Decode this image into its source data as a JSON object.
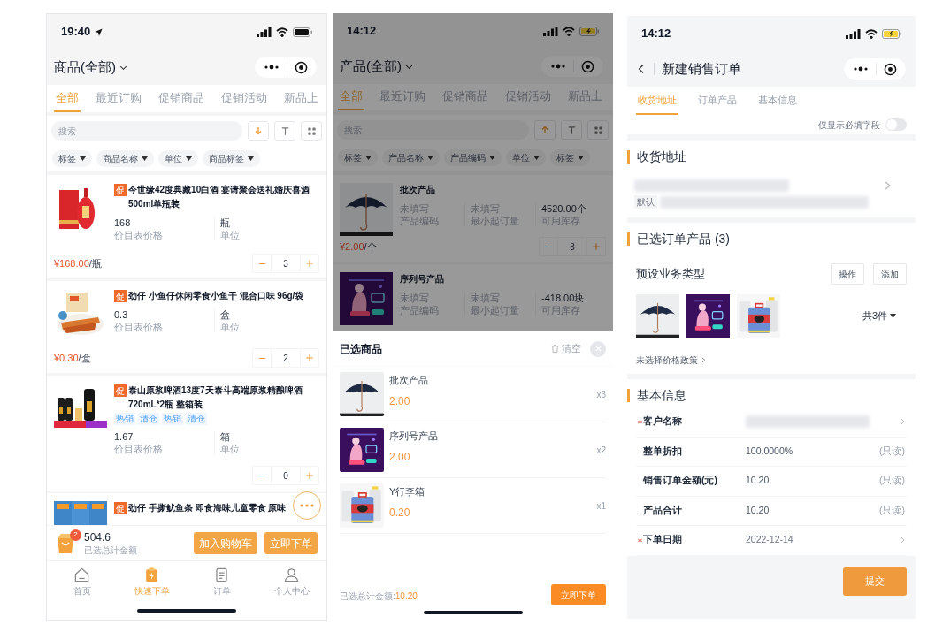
{
  "product_list": {
    "status_bar": {
      "time": "19:40",
      "location": true,
      "charging": false
    },
    "header": {
      "title": "商品(全部)"
    },
    "tabs": [
      {
        "label": "全部",
        "selected": true
      },
      {
        "label": "最近订购",
        "selected": false
      },
      {
        "label": "促销商品",
        "selected": false
      },
      {
        "label": "促销活动",
        "selected": false
      },
      {
        "label": "新品上",
        "selected": false
      }
    ],
    "search": {
      "placeholder": "搜索",
      "sort_ascending": false
    },
    "filters": [
      "标签",
      "商品名称",
      "单位",
      "商品标签"
    ],
    "products": [
      {
        "badge": "促",
        "name": "今世缘42度典藏10白酒 宴请聚会送礼婚庆喜酒500ml单瓶装",
        "fields": [
          {
            "value": "168",
            "label": "价目表价格",
            "empty": false
          },
          {
            "value": "瓶",
            "label": "单位",
            "empty": false
          }
        ],
        "price": "¥168.00",
        "price_unit": "/瓶",
        "quantity": "3"
      },
      {
        "badge": "促",
        "name": "劲仔 小鱼仔休闲零食小鱼干 混合口味 96g/袋",
        "fields": [
          {
            "value": "0.3",
            "label": "价目表价格",
            "empty": false
          },
          {
            "value": "盒",
            "label": "单位",
            "empty": false
          }
        ],
        "price": "¥0.30",
        "price_unit": "/盒",
        "quantity": "2"
      },
      {
        "badge": "促",
        "name": "泰山原浆啤酒13度7天泰斗高端原浆精酿啤酒720mL*2瓶 整箱装",
        "tags": [
          "热销",
          "清仓",
          "热销",
          "清仓"
        ],
        "fields": [
          {
            "value": "1.67",
            "label": "价目表价格",
            "empty": false
          },
          {
            "value": "箱",
            "label": "单位",
            "empty": false
          }
        ],
        "quantity": "0"
      },
      {
        "badge": "促",
        "name": "劲仔 手撕鱿鱼条 即食海味儿童零食 原味"
      }
    ],
    "cart": {
      "count": "2",
      "total": "504.6",
      "total_label": "已选总计金额"
    },
    "actions": [
      "加入购物车",
      "立即下单"
    ],
    "tab_bar": [
      {
        "label": "首页",
        "selected": false
      },
      {
        "label": "快速下单",
        "selected": true
      },
      {
        "label": "订单",
        "selected": false
      },
      {
        "label": "个人中心",
        "selected": false
      }
    ]
  },
  "selected_goods": {
    "status_bar": {
      "time": "14:12",
      "location": false,
      "charging": true
    },
    "header": {
      "title": "产品(全部)"
    },
    "tabs": [
      {
        "label": "全部",
        "selected": true
      },
      {
        "label": "最近订购",
        "selected": false
      },
      {
        "label": "促销商品",
        "selected": false
      },
      {
        "label": "促销活动",
        "selected": false
      },
      {
        "label": "新品上",
        "selected": false
      }
    ],
    "search": {
      "placeholder": "搜索",
      "sort_ascending": true
    },
    "filters": [
      "标签",
      "产品名称",
      "产品编码",
      "单位",
      "标签"
    ],
    "products": [
      {
        "name": "批次产品",
        "fields": [
          {
            "value": "未填写",
            "label": "产品编码",
            "empty": true
          },
          {
            "value": "未填写",
            "label": "最小起订量",
            "empty": true
          },
          {
            "value": "4520.00个",
            "label": "可用库存",
            "empty": false
          }
        ],
        "price": "¥2.00",
        "price_unit": "/个",
        "quantity": "3"
      },
      {
        "name": "序列号产品",
        "fields": [
          {
            "value": "未填写",
            "label": "产品编码",
            "empty": true
          },
          {
            "value": "未填写",
            "label": "最小起订量",
            "empty": true
          },
          {
            "value": "-418.00块",
            "label": "可用库存",
            "empty": false
          }
        ]
      }
    ],
    "sheet": {
      "title": "已选商品",
      "clear_label": "清空",
      "items": [
        {
          "name": "批次产品",
          "price": "2.00",
          "quantity": "x3"
        },
        {
          "name": "序列号产品",
          "price": "2.00",
          "quantity": "x2"
        },
        {
          "name": "Y行李箱",
          "price": "0.20",
          "quantity": "x1"
        }
      ],
      "total_label": "已选总计金额:",
      "total": "10.20",
      "button": "立即下单"
    }
  },
  "new_order": {
    "status_bar": {
      "time": "14:12",
      "location": false,
      "charging": true
    },
    "header": {
      "title": "新建销售订单"
    },
    "tabs": [
      {
        "label": "收货地址",
        "selected": true
      },
      {
        "label": "订单产品",
        "selected": false
      },
      {
        "label": "基本信息",
        "selected": false
      }
    ],
    "required_only": {
      "label": "仅显示必填字段",
      "on": false
    },
    "address": {
      "title": "收货地址",
      "default_tag": "默认"
    },
    "order_products": {
      "title": "已选订单产品 (3)",
      "business_type": "预设业务类型",
      "buttons": [
        "操作",
        "添加"
      ],
      "count": "共3件",
      "price_policy": "未选择价格政策"
    },
    "basic_info": {
      "title": "基本信息",
      "rows": [
        {
          "label": "客户名称",
          "required": true,
          "kind": "link",
          "value_redacted": true
        },
        {
          "label": "整单折扣",
          "required": false,
          "kind": "readonly",
          "value": "100.0000%",
          "note": "(只读)"
        },
        {
          "label": "销售订单金额(元)",
          "required": false,
          "kind": "readonly",
          "value": "10.20",
          "note": "(只读)"
        },
        {
          "label": "产品合计",
          "required": false,
          "kind": "readonly",
          "value": "10.20",
          "note": "(只读)"
        },
        {
          "label": "下单日期",
          "required": true,
          "kind": "link",
          "value": "2022-12-14"
        }
      ]
    },
    "submit": "提交"
  }
}
